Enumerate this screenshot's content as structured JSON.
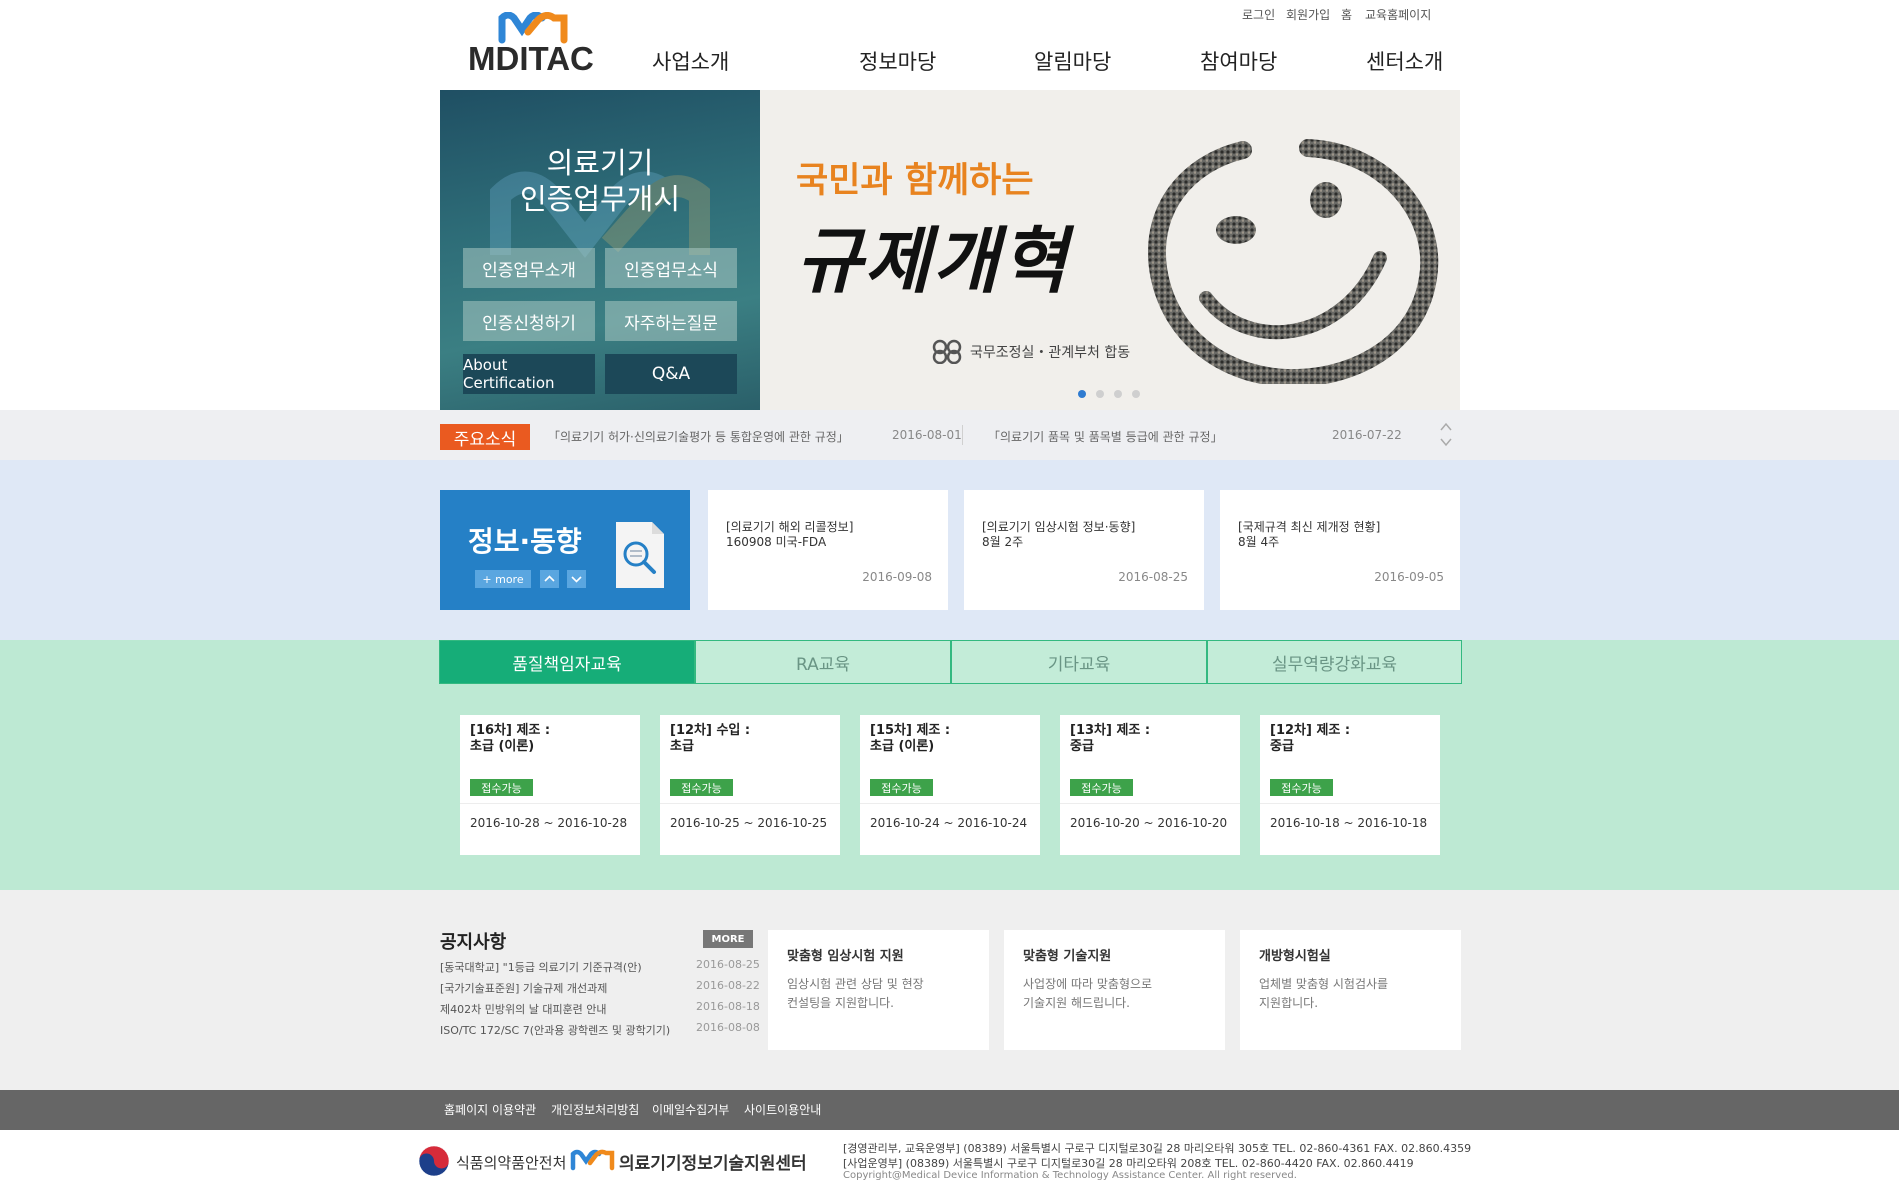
{
  "header": {
    "logo_text": "MDITAC",
    "util_links": [
      "로그인",
      "회원가입",
      "홈",
      "교육홈페이지"
    ],
    "nav": [
      "사업소개",
      "정보마당",
      "알림마당",
      "참여마당",
      "센터소개"
    ]
  },
  "hero": {
    "left": {
      "title_line1": "의료기기",
      "title_line2": "인증업무개시",
      "buttons": [
        "인증업무소개",
        "인증업무소식",
        "인증신청하기",
        "자주하는질문",
        "About Certification",
        "Q&A"
      ]
    },
    "banner": {
      "headline": "국민과 함께하는",
      "calligraphy": "규제개혁",
      "credit": "국무조정실・관계부처 합동"
    },
    "slide_count": 4,
    "active_slide": 1
  },
  "news": {
    "label": "주요소식",
    "items": [
      {
        "title": "「의료기기 허가·신의료기술평가 등 통합운영에 관한 규정」",
        "date": "2016-08-01"
      },
      {
        "title": "「의료기기 품목 및 품목별 등급에 관한 규정」",
        "date": "2016-07-22"
      }
    ]
  },
  "info": {
    "title": "정보·동향",
    "more_label": "+ more",
    "cards": [
      {
        "line1": "[의료기기 해외 리콜정보]",
        "line2": "160908 미국-FDA",
        "date": "2016-09-08"
      },
      {
        "line1": "[의료기기 임상시험 정보·동향]",
        "line2": "8월 2주",
        "date": "2016-08-25"
      },
      {
        "line1": "[국제규격 최신 제개정 현황]",
        "line2": "8월 4주",
        "date": "2016-09-05"
      }
    ]
  },
  "education": {
    "tabs": [
      "품질책임자교육",
      "RA교육",
      "기타교육",
      "실무역량강화교육"
    ],
    "active_tab": 0,
    "courses": [
      {
        "line1": "[16차] 제조 :",
        "line2": "초급 (이론)",
        "status": "접수가능",
        "period": "2016-10-28 ~ 2016-10-28"
      },
      {
        "line1": "[12차] 수입 :",
        "line2": "초급",
        "status": "접수가능",
        "period": "2016-10-25 ~ 2016-10-25"
      },
      {
        "line1": "[15차] 제조 :",
        "line2": "초급 (이론)",
        "status": "접수가능",
        "period": "2016-10-24 ~ 2016-10-24"
      },
      {
        "line1": "[13차] 제조 :",
        "line2": "중급",
        "status": "접수가능",
        "period": "2016-10-20 ~ 2016-10-20"
      },
      {
        "line1": "[12차] 제조 :",
        "line2": "중급",
        "status": "접수가능",
        "period": "2016-10-18 ~ 2016-10-18"
      }
    ]
  },
  "notice": {
    "title": "공지사항",
    "more_label": "MORE",
    "items": [
      {
        "title": "[동국대학교] \"1등급 의료기기 기준규격(안)",
        "date": "2016-08-25"
      },
      {
        "title": "[국가기술표준원] 기술규제 개선과제",
        "date": "2016-08-22"
      },
      {
        "title": "제402차 민방위의 날 대피훈련 안내",
        "date": "2016-08-18"
      },
      {
        "title": "ISO/TC 172/SC 7(안과용 광학렌즈 및 광학기기)",
        "date": "2016-08-08"
      }
    ]
  },
  "services": [
    {
      "title": "맞춤형 임상시험 지원",
      "desc": "임상시험 관련 상담 및 현장\n컨설팅을 지원합니다."
    },
    {
      "title": "맞춤형 기술지원",
      "desc": "사업장에 따라 맞춤형으로\n기술지원 해드립니다."
    },
    {
      "title": "개방형시험실",
      "desc": "업체별 맞춤형 시험검사를\n지원합니다."
    }
  ],
  "footer": {
    "links": [
      "홈페이지 이용약관",
      "개인정보처리방침",
      "이메일수집거부",
      "사이트이용안내"
    ],
    "mfds_name": "식품의약품안전처",
    "center_name": "의료기기정보기술지원센터",
    "address_lines": [
      "[경영관리부, 교육운영부] (08389) 서울특별시 구로구 디지털로30길 28 마리오타워 305호 TEL. 02-860-4361   FAX. 02.860.4359",
      "[사업운영부]                    (08389) 서울특별시 구로구 디지털로30길 28 마리오타워 208호 TEL. 02-860-4420   FAX. 02.860.4419"
    ],
    "copyright": "Copyright@Medical Device Information & Technology Assistance Center. All right reserved."
  },
  "colors": {
    "news_label": "#ea5a20",
    "info_blue": "#2580c6",
    "edu_green": "#16ad78",
    "badge_green": "#3da24a",
    "active_dot": "#2f7bd0"
  }
}
